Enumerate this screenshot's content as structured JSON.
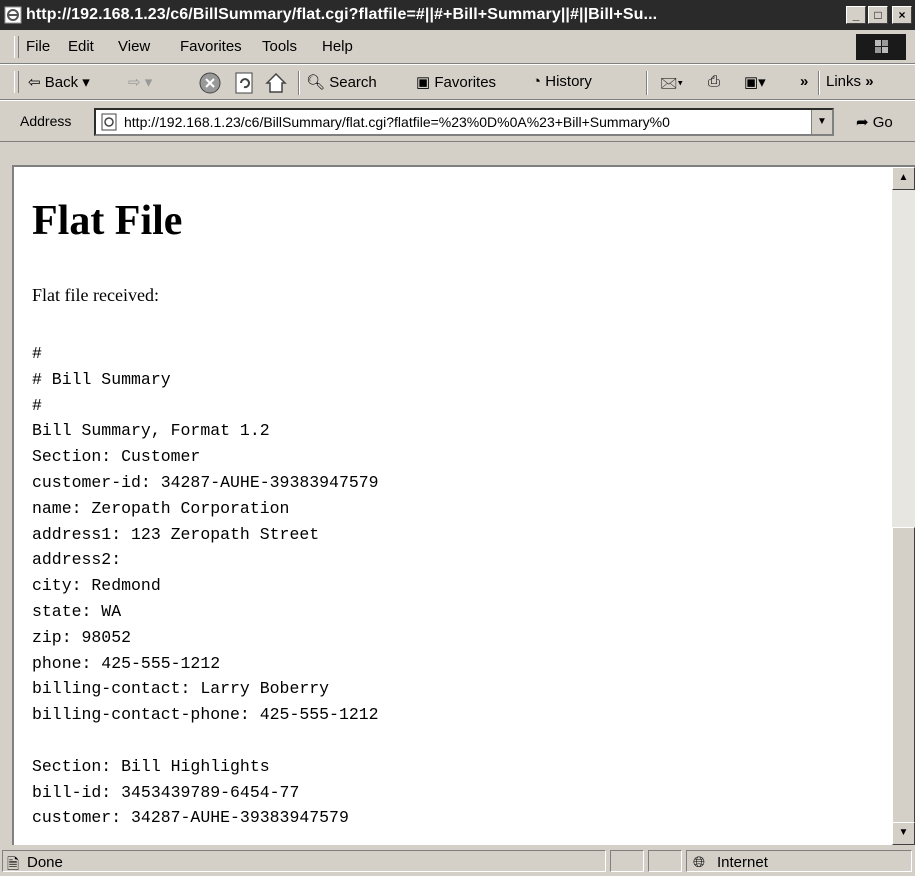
{
  "window": {
    "title": "http://192.168.1.23/c6/BillSummary/flat.cgi?flatfile=#||#+Bill+Summary||#||Bill+Su...",
    "icon": "ie-page-icon",
    "controls": {
      "minimize": "_",
      "maximize": "□",
      "close": "×"
    }
  },
  "menu": {
    "items": [
      "File",
      "Edit",
      "View",
      "Favorites",
      "Tools",
      "Help"
    ]
  },
  "toolbar": {
    "back": "Back",
    "search": "Search",
    "favorites": "Favorites",
    "history": "History",
    "chevron": "»",
    "links": "Links"
  },
  "address": {
    "label": "Address",
    "url": "http://192.168.1.23/c6/BillSummary/flat.cgi?flatfile=%23%0D%0A%23+Bill+Summary%0",
    "go": "Go"
  },
  "page": {
    "heading": "Flat File",
    "intro": "Flat file received:",
    "flatfile_lines": [
      "#",
      "# Bill Summary",
      "#",
      "Bill Summary, Format 1.2",
      "Section: Customer",
      "customer-id: 34287-AUHE-39383947579",
      "name: Zeropath Corporation",
      "address1: 123 Zeropath Street",
      "address2:",
      "city: Redmond",
      "state: WA",
      "zip: 98052",
      "phone: 425-555-1212",
      "billing-contact: Larry Boberry",
      "billing-contact-phone: 425-555-1212",
      "",
      "Section: Bill Highlights",
      "bill-id: 3453439789-6454-77",
      "customer: 34287-AUHE-39383947579"
    ]
  },
  "status": {
    "text": "Done",
    "zone": "Internet"
  }
}
